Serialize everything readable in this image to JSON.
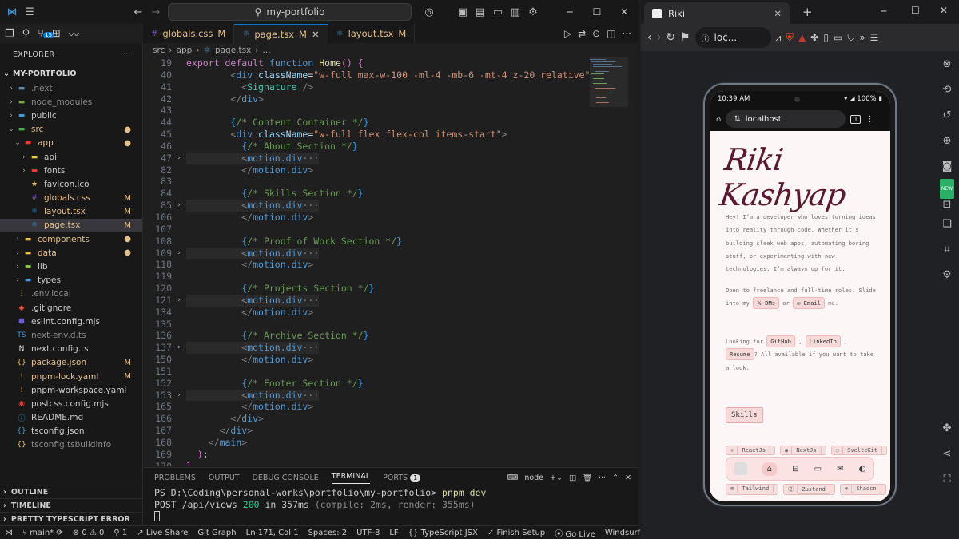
{
  "vscode": {
    "title": "my-portfolio",
    "tabs": [
      {
        "label": "globals.css",
        "mark": "M",
        "type": "css"
      },
      {
        "label": "page.tsx",
        "mark": "M",
        "type": "tsx"
      },
      {
        "label": "layout.tsx",
        "mark": "M",
        "type": "tsx"
      }
    ],
    "explorer_title": "EXPLORER",
    "project": "MY-PORTFOLIO",
    "tree": [
      {
        "indent": 1,
        "chev": "›",
        "icon": "folder",
        "color": "#5a8ebd",
        "label": ".next",
        "lc": "#8b8b8b",
        "mark": ""
      },
      {
        "indent": 1,
        "chev": "›",
        "icon": "folder",
        "color": "#7aa84b",
        "label": "node_modules",
        "lc": "#8b8b8b",
        "mark": ""
      },
      {
        "indent": 1,
        "chev": "›",
        "icon": "folder",
        "color": "#3f9bd8",
        "label": "public",
        "lc": "#ccc",
        "mark": ""
      },
      {
        "indent": 1,
        "chev": "⌄",
        "icon": "folder",
        "color": "#4caf50",
        "label": "src",
        "lc": "#e2c08d",
        "mark": "●",
        "mc": "#e2c08d"
      },
      {
        "indent": 2,
        "chev": "⌄",
        "icon": "folder",
        "color": "#e53935",
        "label": "app",
        "lc": "#e2c08d",
        "mark": "●",
        "mc": "#e2c08d"
      },
      {
        "indent": 3,
        "chev": "›",
        "icon": "folder",
        "color": "#e8c547",
        "label": "api",
        "lc": "#ccc",
        "mark": ""
      },
      {
        "indent": 3,
        "chev": "›",
        "icon": "folder",
        "color": "#e53935",
        "label": "fonts",
        "lc": "#ccc",
        "mark": ""
      },
      {
        "indent": 3,
        "chev": "",
        "icon": "star",
        "color": "#e8c547",
        "label": "favicon.ico",
        "lc": "#ccc",
        "mark": ""
      },
      {
        "indent": 3,
        "chev": "",
        "icon": "css",
        "color": "#7e57c2",
        "label": "globals.css",
        "lc": "#e2c08d",
        "mark": "M",
        "mc": "#e2c08d"
      },
      {
        "indent": 3,
        "chev": "",
        "icon": "tsx",
        "color": "#3f9bd8",
        "label": "layout.tsx",
        "lc": "#e2c08d",
        "mark": "M",
        "mc": "#e2c08d"
      },
      {
        "indent": 3,
        "chev": "",
        "icon": "tsx",
        "color": "#3f9bd8",
        "label": "page.tsx",
        "lc": "#e2c08d",
        "mark": "M",
        "mc": "#e2c08d",
        "sel": true
      },
      {
        "indent": 2,
        "chev": "›",
        "icon": "folder",
        "color": "#e8c547",
        "label": "components",
        "lc": "#e2c08d",
        "mark": "●",
        "mc": "#e2c08d"
      },
      {
        "indent": 2,
        "chev": "›",
        "icon": "folder",
        "color": "#e8c547",
        "label": "data",
        "lc": "#e2c08d",
        "mark": "●",
        "mc": "#e2c08d"
      },
      {
        "indent": 2,
        "chev": "›",
        "icon": "folder",
        "color": "#8bc34a",
        "label": "lib",
        "lc": "#ccc",
        "mark": ""
      },
      {
        "indent": 2,
        "chev": "›",
        "icon": "folder",
        "color": "#3f9bd8",
        "label": "types",
        "lc": "#ccc",
        "mark": ""
      },
      {
        "indent": 1,
        "chev": "",
        "icon": "env",
        "color": "#e8a33b",
        "label": ".env.local",
        "lc": "#8b8b8b",
        "mark": ""
      },
      {
        "indent": 1,
        "chev": "",
        "icon": "git",
        "color": "#e84e31",
        "label": ".gitignore",
        "lc": "#ccc",
        "mark": ""
      },
      {
        "indent": 1,
        "chev": "",
        "icon": "eslint",
        "color": "#6b5bd6",
        "label": "eslint.config.mjs",
        "lc": "#ccc",
        "mark": ""
      },
      {
        "indent": 1,
        "chev": "",
        "icon": "ts",
        "color": "#3f9bd8",
        "label": "next-env.d.ts",
        "lc": "#8b8b8b",
        "mark": ""
      },
      {
        "indent": 1,
        "chev": "",
        "icon": "next",
        "color": "#eee",
        "label": "next.config.ts",
        "lc": "#ccc",
        "mark": ""
      },
      {
        "indent": 1,
        "chev": "",
        "icon": "json",
        "color": "#e8c547",
        "label": "package.json",
        "lc": "#e2c08d",
        "mark": "M",
        "mc": "#e2c08d"
      },
      {
        "indent": 1,
        "chev": "",
        "icon": "yaml",
        "color": "#e8a33b",
        "label": "pnpm-lock.yaml",
        "lc": "#e2c08d",
        "mark": "M",
        "mc": "#e2c08d"
      },
      {
        "indent": 1,
        "chev": "",
        "icon": "yaml",
        "color": "#e8a33b",
        "label": "pnpm-workspace.yaml",
        "lc": "#ccc",
        "mark": ""
      },
      {
        "indent": 1,
        "chev": "",
        "icon": "postcss",
        "color": "#e53935",
        "label": "postcss.config.mjs",
        "lc": "#ccc",
        "mark": ""
      },
      {
        "indent": 1,
        "chev": "",
        "icon": "info",
        "color": "#3f9bd8",
        "label": "README.md",
        "lc": "#ccc",
        "mark": ""
      },
      {
        "indent": 1,
        "chev": "",
        "icon": "json",
        "color": "#3f9bd8",
        "label": "tsconfig.json",
        "lc": "#ccc",
        "mark": ""
      },
      {
        "indent": 1,
        "chev": "",
        "icon": "json",
        "color": "#e8c547",
        "label": "tsconfig.tsbuildinfo",
        "lc": "#8b8b8b",
        "mark": ""
      }
    ],
    "panels": [
      "OUTLINE",
      "TIMELINE",
      "PRETTY TYPESCRIPT ERROR"
    ],
    "breadcrumb": [
      "src",
      "app",
      "page.tsx",
      "..."
    ],
    "code_lines": [
      {
        "n": "19",
        "f": "",
        "hl": false,
        "html": "<span class='kw'>export</span> <span class='kw'>default</span> <span class='tag'>function</span> <span class='fn'>Home</span><span class='br'>()</span> <span class='br'>{</span>"
      },
      {
        "n": "40",
        "f": "",
        "hl": false,
        "html": "        <span class='gy'>&lt;</span><span class='tag'>div</span> <span class='at'>className</span>=<span class='st'>\"w-full max-w-100 -ml-4 -mb-6 -mt-4 z-20 relative\"</span><span class='gy'>&gt;</span>"
      },
      {
        "n": "41",
        "f": "",
        "hl": false,
        "html": "          <span class='gy'>&lt;</span><span class='fn' style='color:#4ec9b0'>Signature</span> <span class='gy'>/&gt;</span>"
      },
      {
        "n": "42",
        "f": "",
        "hl": false,
        "html": "        <span class='gy'>&lt;/</span><span class='tag'>div</span><span class='gy'>&gt;</span>"
      },
      {
        "n": "43",
        "f": "",
        "hl": false,
        "html": ""
      },
      {
        "n": "44",
        "f": "",
        "hl": false,
        "html": "        <span class='br2'>{</span><span class='cm'>/* Content Container */</span><span class='br2'>}</span>"
      },
      {
        "n": "45",
        "f": "",
        "hl": false,
        "html": "        <span class='gy'>&lt;</span><span class='tag'>div</span> <span class='at'>className</span>=<span class='st'>\"w-full flex flex-col items-start\"</span><span class='gy'>&gt;</span>"
      },
      {
        "n": "46",
        "f": "",
        "hl": false,
        "html": "          <span class='br2'>{</span><span class='cm'>/* About Section */</span><span class='br2'>}</span>"
      },
      {
        "n": "47",
        "f": "›",
        "hl": true,
        "html": "          <span class='gy'>&lt;</span><span class='tag'>motion.div</span><span class='gy'>···</span>"
      },
      {
        "n": "82",
        "f": "",
        "hl": false,
        "html": "          <span class='gy'>&lt;/</span><span class='tag'>motion.div</span><span class='gy'>&gt;</span>"
      },
      {
        "n": "83",
        "f": "",
        "hl": false,
        "html": ""
      },
      {
        "n": "84",
        "f": "",
        "hl": false,
        "html": "          <span class='br2'>{</span><span class='cm'>/* Skills Section */</span><span class='br2'>}</span>"
      },
      {
        "n": "85",
        "f": "›",
        "hl": true,
        "html": "          <span class='gy'>&lt;</span><span class='tag'>motion.div</span><span class='gy'>···</span>"
      },
      {
        "n": "106",
        "f": "",
        "hl": false,
        "html": "          <span class='gy'>&lt;/</span><span class='tag'>motion.div</span><span class='gy'>&gt;</span>"
      },
      {
        "n": "107",
        "f": "",
        "hl": false,
        "html": ""
      },
      {
        "n": "108",
        "f": "",
        "hl": false,
        "html": "          <span class='br2'>{</span><span class='cm'>/* Proof of Work Section */</span><span class='br2'>}</span>"
      },
      {
        "n": "109",
        "f": "›",
        "hl": true,
        "html": "          <span class='gy'>&lt;</span><span class='tag'>motion.div</span><span class='gy'>···</span>"
      },
      {
        "n": "118",
        "f": "",
        "hl": false,
        "html": "          <span class='gy'>&lt;/</span><span class='tag'>motion.div</span><span class='gy'>&gt;</span>"
      },
      {
        "n": "119",
        "f": "",
        "hl": false,
        "html": ""
      },
      {
        "n": "120",
        "f": "",
        "hl": false,
        "html": "          <span class='br2'>{</span><span class='cm'>/* Projects Section */</span><span class='br2'>}</span>"
      },
      {
        "n": "121",
        "f": "›",
        "hl": true,
        "html": "          <span class='gy'>&lt;</span><span class='tag'>motion.div</span><span class='gy'>···</span>"
      },
      {
        "n": "134",
        "f": "",
        "hl": false,
        "html": "          <span class='gy'>&lt;/</span><span class='tag'>motion.div</span><span class='gy'>&gt;</span>"
      },
      {
        "n": "135",
        "f": "",
        "hl": false,
        "html": ""
      },
      {
        "n": "136",
        "f": "",
        "hl": false,
        "html": "          <span class='br2'>{</span><span class='cm'>/* Archive Section */</span><span class='br2'>}</span>"
      },
      {
        "n": "137",
        "f": "›",
        "hl": true,
        "html": "          <span class='gy'>&lt;</span><span class='tag'>motion.div</span><span class='gy'>···</span>"
      },
      {
        "n": "150",
        "f": "",
        "hl": false,
        "html": "          <span class='gy'>&lt;/</span><span class='tag'>motion.div</span><span class='gy'>&gt;</span>"
      },
      {
        "n": "151",
        "f": "",
        "hl": false,
        "html": ""
      },
      {
        "n": "152",
        "f": "",
        "hl": false,
        "html": "          <span class='br2'>{</span><span class='cm'>/* Footer Section */</span><span class='br2'>}</span>"
      },
      {
        "n": "153",
        "f": "›",
        "hl": true,
        "html": "          <span class='gy'>&lt;</span><span class='tag'>motion.div</span><span class='gy'>···</span>"
      },
      {
        "n": "165",
        "f": "",
        "hl": false,
        "html": "          <span class='gy'>&lt;/</span><span class='tag'>motion.div</span><span class='gy'>&gt;</span>"
      },
      {
        "n": "166",
        "f": "",
        "hl": false,
        "html": "        <span class='gy'>&lt;/</span><span class='tag'>div</span><span class='gy'>&gt;</span>"
      },
      {
        "n": "167",
        "f": "",
        "hl": false,
        "html": "      <span class='gy'>&lt;/</span><span class='tag'>div</span><span class='gy'>&gt;</span>"
      },
      {
        "n": "168",
        "f": "",
        "hl": false,
        "html": "    <span class='gy'>&lt;/</span><span class='tag'>main</span><span class='gy'>&gt;</span>"
      },
      {
        "n": "169",
        "f": "",
        "hl": false,
        "html": "  <span class='br'>)</span>;"
      },
      {
        "n": "170",
        "f": "",
        "hl": false,
        "html": "<span class='br'>}</span>"
      }
    ],
    "panel_tabs": [
      "PROBLEMS",
      "OUTPUT",
      "DEBUG CONSOLE",
      "TERMINAL",
      "PORTS"
    ],
    "ports_count": "1",
    "terminal_shell": "node",
    "terminal": {
      "prompt": "PS D:\\Coding\\personal-works\\portfolio\\my-portfolio>",
      "cmd": "pnpm dev",
      "line2_a": " POST /api/views ",
      "line2_code": "200",
      "line2_b": " in 357ms ",
      "line2_c": "(compile: 2ms, render: 355ms)"
    },
    "status": {
      "branch": "main*",
      "errors": "0",
      "warnings": "0",
      "ports": "1",
      "live_share": "Live Share",
      "git_graph": "Git Graph",
      "position": "Ln 171, Col 1",
      "spaces": "Spaces: 2",
      "encoding": "UTF-8",
      "eol": "LF",
      "language": "TypeScript JSX",
      "finish": "Finish Setup",
      "go_live": "Go Live",
      "windsurf": "Windsurf: {...}"
    }
  },
  "browser": {
    "tab_title": "Riki",
    "url": "loc...",
    "phone": {
      "time": "10:39 AM",
      "battery": "100%",
      "address": "localhost",
      "tabs_count": "1",
      "signature": "Riki Kashyap",
      "intro": "Hey! I’m a developer who loves turning ideas into reality through code. Whether it’s building sleek web apps, automating boring stuff, or experimenting with new technologies, I’m always up for it.",
      "open_a": "Open to freelance and full-time roles. Slide into my",
      "dms": "DMs",
      "or": "or",
      "email": "Email",
      "me": "me.",
      "looking": "Looking for",
      "github": "GitHub",
      "linkedin": "LinkedIn",
      "resume": "Resume",
      "available": "? All available if you want to take a look.",
      "skills_title": "Skills",
      "skills_row1": [
        "ReactJs",
        "NextJs",
        "SvelteKit"
      ],
      "skills_row2": [
        "Tailwind",
        "Zustand",
        "Shadcn"
      ]
    },
    "new_badge": "NEW"
  }
}
